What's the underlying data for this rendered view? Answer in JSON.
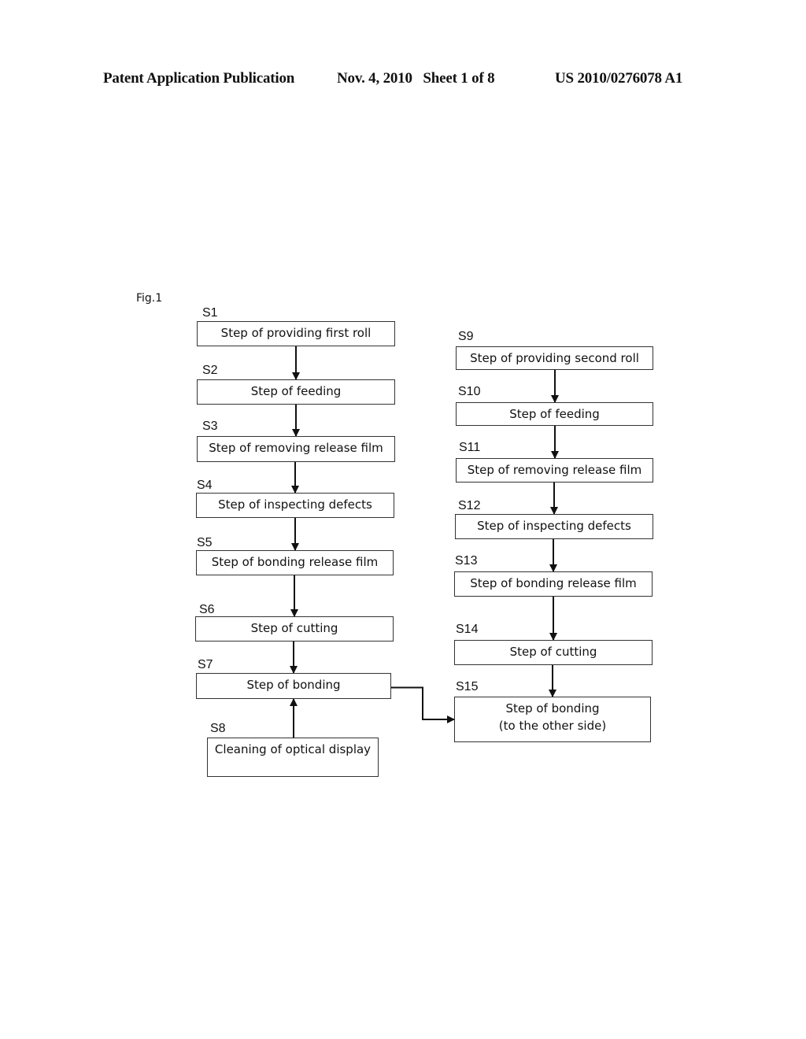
{
  "header": {
    "publication": "Patent Application Publication",
    "date_sheet": "Nov. 4, 2010   Sheet 1 of 8",
    "number": "US 2010/0276078 A1"
  },
  "figure": {
    "label": "Fig.1",
    "left_column": [
      {
        "id": "S1",
        "text": "Step of providing first roll"
      },
      {
        "id": "S2",
        "text": "Step of feeding"
      },
      {
        "id": "S3",
        "text": "Step of removing release film"
      },
      {
        "id": "S4",
        "text": "Step of inspecting defects"
      },
      {
        "id": "S5",
        "text": "Step of bonding release film"
      },
      {
        "id": "S6",
        "text": "Step of cutting"
      },
      {
        "id": "S7",
        "text": "Step of bonding"
      },
      {
        "id": "S8",
        "text": "Cleaning of optical display"
      }
    ],
    "right_column": [
      {
        "id": "S9",
        "text": "Step of providing second roll"
      },
      {
        "id": "S10",
        "text": "Step of feeding"
      },
      {
        "id": "S11",
        "text": "Step of removing release film"
      },
      {
        "id": "S12",
        "text": "Step of inspecting defects"
      },
      {
        "id": "S13",
        "text": "Step of bonding release film"
      },
      {
        "id": "S14",
        "text": "Step of cutting"
      },
      {
        "id": "S15",
        "text": "Step of bonding",
        "text2": "(to the other side)"
      }
    ],
    "edges": [
      [
        "S1",
        "S2"
      ],
      [
        "S2",
        "S3"
      ],
      [
        "S3",
        "S4"
      ],
      [
        "S4",
        "S5"
      ],
      [
        "S5",
        "S6"
      ],
      [
        "S6",
        "S7"
      ],
      [
        "S8",
        "S7"
      ],
      [
        "S9",
        "S10"
      ],
      [
        "S10",
        "S11"
      ],
      [
        "S11",
        "S12"
      ],
      [
        "S12",
        "S13"
      ],
      [
        "S13",
        "S14"
      ],
      [
        "S14",
        "S15"
      ],
      [
        "S7",
        "S15"
      ]
    ]
  }
}
